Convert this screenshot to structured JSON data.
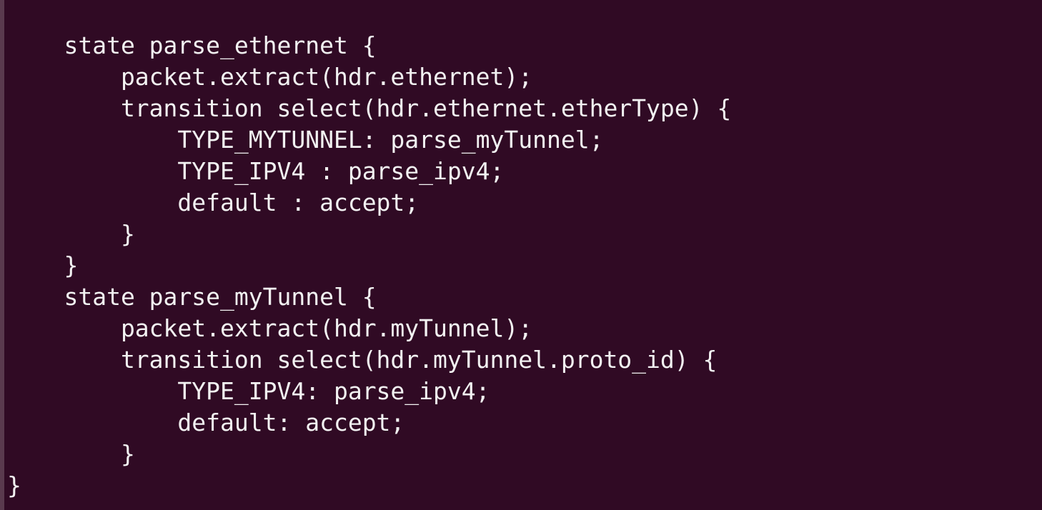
{
  "terminal": {
    "lines": [
      "    state parse_ethernet {",
      "        packet.extract(hdr.ethernet);",
      "        transition select(hdr.ethernet.etherType) {",
      "            TYPE_MYTUNNEL: parse_myTunnel;",
      "            TYPE_IPV4 : parse_ipv4;",
      "            default : accept;",
      "        }",
      "    }",
      "    state parse_myTunnel {",
      "        packet.extract(hdr.myTunnel);",
      "        transition select(hdr.myTunnel.proto_id) {",
      "            TYPE_IPV4: parse_ipv4;",
      "            default: accept;",
      "        }",
      "}"
    ],
    "colors": {
      "background": "#300a24",
      "text": "#f2f2f2"
    }
  }
}
